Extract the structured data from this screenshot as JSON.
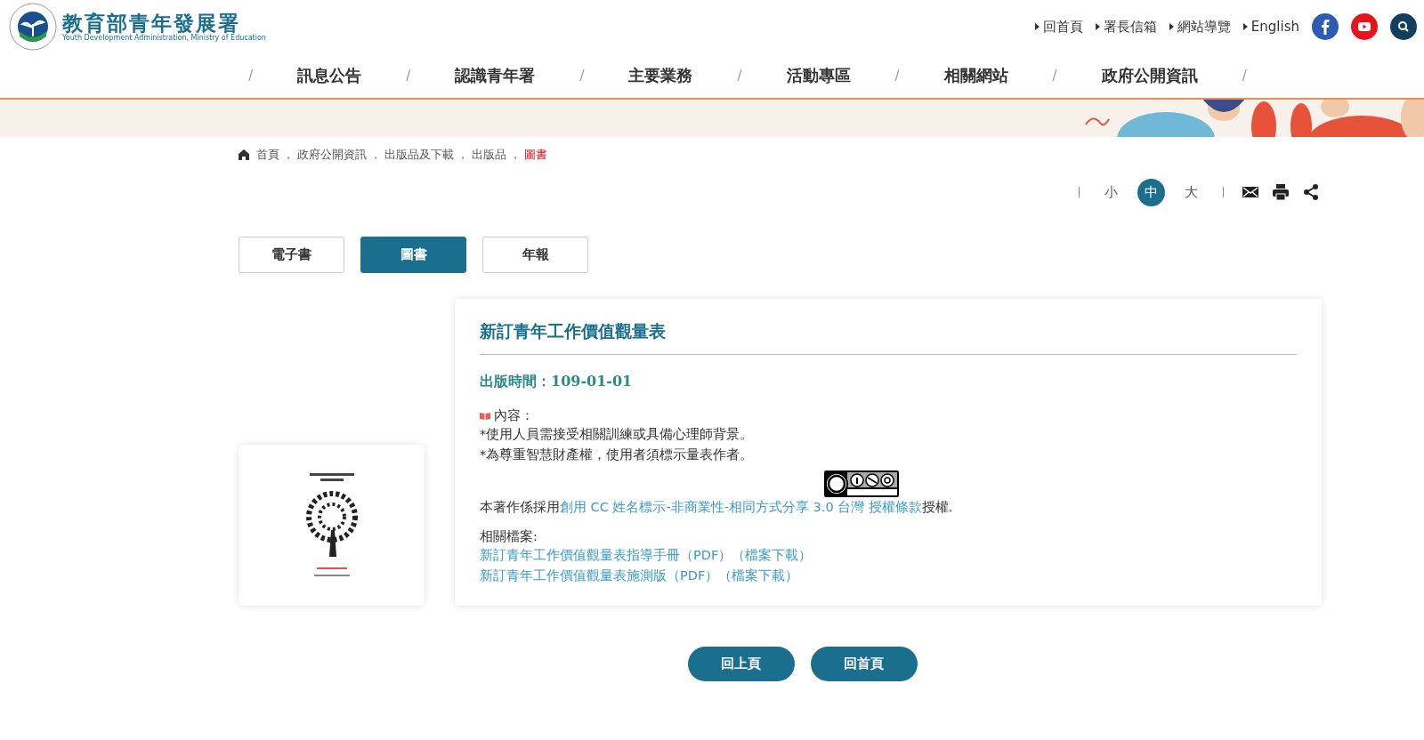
{
  "header": {
    "logo_title": "教育部青年發展署",
    "logo_subtitle": "Youth Development Administration, Ministry of Education",
    "top_links": [
      "回首頁",
      "署長信箱",
      "網站導覽",
      "English"
    ]
  },
  "nav": {
    "separator": "/",
    "items": [
      {
        "label": "訊息公告",
        "selected": false
      },
      {
        "label": "認識青年署",
        "selected": false
      },
      {
        "label": "主要業務",
        "selected": false
      },
      {
        "label": "活動專區",
        "selected": false
      },
      {
        "label": "相關網站",
        "selected": false
      },
      {
        "label": "政府公開資訊",
        "selected": false
      }
    ]
  },
  "breadcrumb": {
    "separator": "，",
    "items": [
      {
        "label": "首頁",
        "current": false
      },
      {
        "label": "政府公開資訊",
        "current": false
      },
      {
        "label": "出版品及下載",
        "current": false
      },
      {
        "label": "出版品",
        "current": false
      },
      {
        "label": "圖書",
        "current": true
      }
    ]
  },
  "font_size": [
    {
      "label": "小",
      "selected": false
    },
    {
      "label": "中",
      "selected": true
    },
    {
      "label": "大",
      "selected": false
    }
  ],
  "tabs": [
    {
      "label": "電子書",
      "selected": false
    },
    {
      "label": "圖書",
      "selected": true
    },
    {
      "label": "年報",
      "selected": false
    }
  ],
  "publication": {
    "title": "新訂青年工作價值觀量表",
    "date": "出版時間：109-01-01",
    "content_label": "內容：",
    "content_lines": [
      "*使用人員需接受相關訓練或具備心理師背景。",
      "*為尊重智慧財產權，使用者須標示量表作者。"
    ],
    "license_prefix": "本著作係採用",
    "license_link": "創用 CC 姓名標示-非商業性-相同方式分享 3.0 台灣 授權條款",
    "license_suffix": "授權.",
    "files_label": "相關檔案:",
    "files": [
      "新訂青年工作價值觀量表指導手冊（PDF）（檔案下載）",
      "新訂青年工作價值觀量表施測版（PDF）（檔案下載）"
    ]
  },
  "buttons": [
    "回上頁",
    "回首頁"
  ]
}
